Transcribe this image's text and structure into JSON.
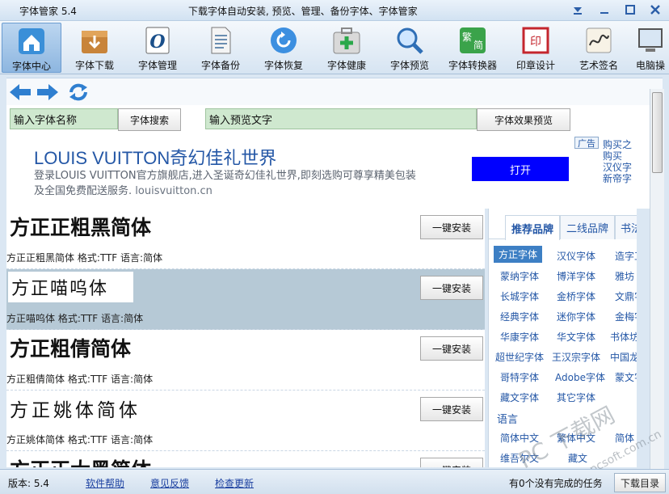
{
  "window": {
    "app_title": "字体管家 5.4",
    "subtitle": "下载字体自动安装, 预览、管理、备份字体、字体管家"
  },
  "toolbar": [
    {
      "label": "字体中心",
      "icon": "home-icon",
      "active": true
    },
    {
      "label": "字体下载",
      "icon": "download-box-icon",
      "active": false
    },
    {
      "label": "字体管理",
      "icon": "font-o-icon",
      "active": false
    },
    {
      "label": "字体备份",
      "icon": "document-icon",
      "active": false
    },
    {
      "label": "字体恢复",
      "icon": "restore-icon",
      "active": false
    },
    {
      "label": "字体健康",
      "icon": "first-aid-icon",
      "active": false
    },
    {
      "label": "字体预览",
      "icon": "magnifier-icon",
      "active": false
    },
    {
      "label": "字体转换器",
      "icon": "convert-icon",
      "active": false
    },
    {
      "label": "印章设计",
      "icon": "seal-icon",
      "active": false
    },
    {
      "label": "艺术签名",
      "icon": "signature-icon",
      "active": false
    },
    {
      "label": "电脑操",
      "icon": "computer-icon",
      "active": false
    }
  ],
  "search": {
    "font_name_value": "输入字体名称",
    "search_button": "字体搜索",
    "preview_text_value": "输入预览文字",
    "preview_button": "字体效果预览"
  },
  "ad": {
    "title": "LOUIS VUITTON奇幻佳礼世界",
    "line1": "登录LOUIS VUITTON官方旗舰店,进入圣诞奇幻佳礼世界,即刻选购可尊享精美包装",
    "line2": "及全国免费配送服务.",
    "domain": "louisvuitton.cn",
    "open_button": "打开",
    "badge": "广告",
    "side_links": [
      "购买之",
      "购买",
      "汉仪字",
      "新帝字"
    ]
  },
  "fonts": [
    {
      "preview": "方正正粗黑简体",
      "info": "方正正粗黑简体  格式:TTF 语言:简体",
      "install": "一键安装"
    },
    {
      "preview": "方正喵呜体",
      "info": "方正喵呜体  格式:TTF 语言:简体",
      "install": "一键安装"
    },
    {
      "preview": "方正粗倩简体",
      "info": "方正粗倩简体  格式:TTF 语言:简体",
      "install": "一键安装"
    },
    {
      "preview": "方正姚体简体",
      "info": "方正姚体简体  格式:TTF 语言:简体",
      "install": "一键安装"
    },
    {
      "preview": "方正正大黑简体",
      "info": "",
      "install": "一键安装"
    }
  ],
  "right_panel": {
    "tabs": [
      "推荐品牌",
      "二线品牌",
      "书法"
    ],
    "brands": [
      [
        "方正字体",
        "汉仪字体",
        "造字工"
      ],
      [
        "蒙纳字体",
        "博洋字体",
        "雅坊"
      ],
      [
        "长城字体",
        "金桥字体",
        "文鼎字"
      ],
      [
        "经典字体",
        "迷你字体",
        "金梅字"
      ],
      [
        "华康字体",
        "华文字体",
        "书体坊"
      ],
      [
        "超世纪字体",
        "王汉宗字体",
        "中国龙"
      ],
      [
        "哥特字体",
        "Adobe字体",
        "蒙文字"
      ],
      [
        "藏文字体",
        "其它字体",
        ""
      ]
    ],
    "lang_title": "语言",
    "langs": [
      [
        "简体中文",
        "繁体中文",
        "简体"
      ],
      [
        "维吾尔文",
        "藏文",
        ""
      ]
    ]
  },
  "statusbar": {
    "version": "版本: 5.4",
    "help": "软件帮助",
    "feedback": "意见反馈",
    "update": "检查更新",
    "tasks": "有0个没有完成的任务",
    "download_dir": "下载目录"
  },
  "watermark": {
    "main": "PC 下载网",
    "domain": "www.pcsoft.com.cn"
  },
  "colors": {
    "accent": "#2457a6",
    "ad_button": "#0000ff",
    "input_bg": "#cfe8cf",
    "selected_row": "#b6c9d6"
  }
}
